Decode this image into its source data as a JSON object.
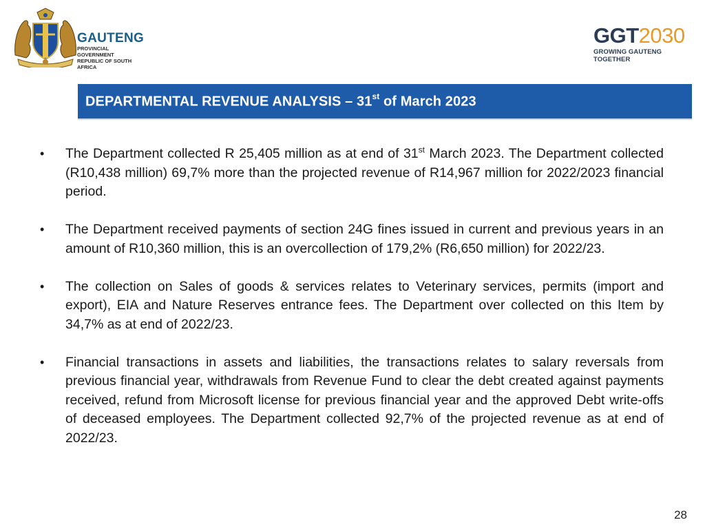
{
  "header": {
    "gov_logo": {
      "icon": "gauteng-coat-of-arms-icon",
      "name": "GAUTENG",
      "line1": "PROVINCIAL GOVERNMENT",
      "line2": "REPUBLIC OF SOUTH AFRICA"
    },
    "ggt_logo": {
      "mark_main": "GGT",
      "mark_year": "2030",
      "tagline": "GROWING GAUTENG TOGETHER"
    }
  },
  "title": {
    "prefix": "DEPARTMENTAL REVENUE ANALYSIS – 31",
    "sup": "st",
    "suffix": " of March 2023"
  },
  "bullets": [
    {
      "before": "The Department collected R 25,405 million as at end of 31",
      "sup": "st",
      "after": " March 2023. The Department collected (R10,438 million) 69,7% more than the projected revenue of R14,967 million for 2022/2023 financial period."
    },
    {
      "before": "The Department received payments of section 24G fines issued in current and previous years in an amount of R10,360 million, this is an overcollection of 179,2% (R6,650 million) for 2022/23.",
      "sup": "",
      "after": ""
    },
    {
      "before": "The collection on Sales of goods & services relates to Veterinary services, permits (import and export), EIA and Nature Reserves entrance fees. The Department over collected on this Item by 34,7% as at end of 2022/23.",
      "sup": "",
      "after": ""
    },
    {
      "before": "Financial transactions in assets and liabilities, the transactions relates to salary reversals from previous financial year, withdrawals from Revenue Fund to clear the debt created against payments received, refund from Microsoft license for previous financial year and the approved Debt write-offs of deceased employees. The Department collected 92,7% of the projected revenue as at end of 2022/23.",
      "sup": "",
      "after": ""
    }
  ],
  "bullet_symbol": "•",
  "page_number": "28",
  "colors": {
    "banner": "#1e5caa",
    "gauteng_blue": "#1b5e8a",
    "ggt_navy": "#2b3d55",
    "ggt_orange": "#e79a2a"
  }
}
